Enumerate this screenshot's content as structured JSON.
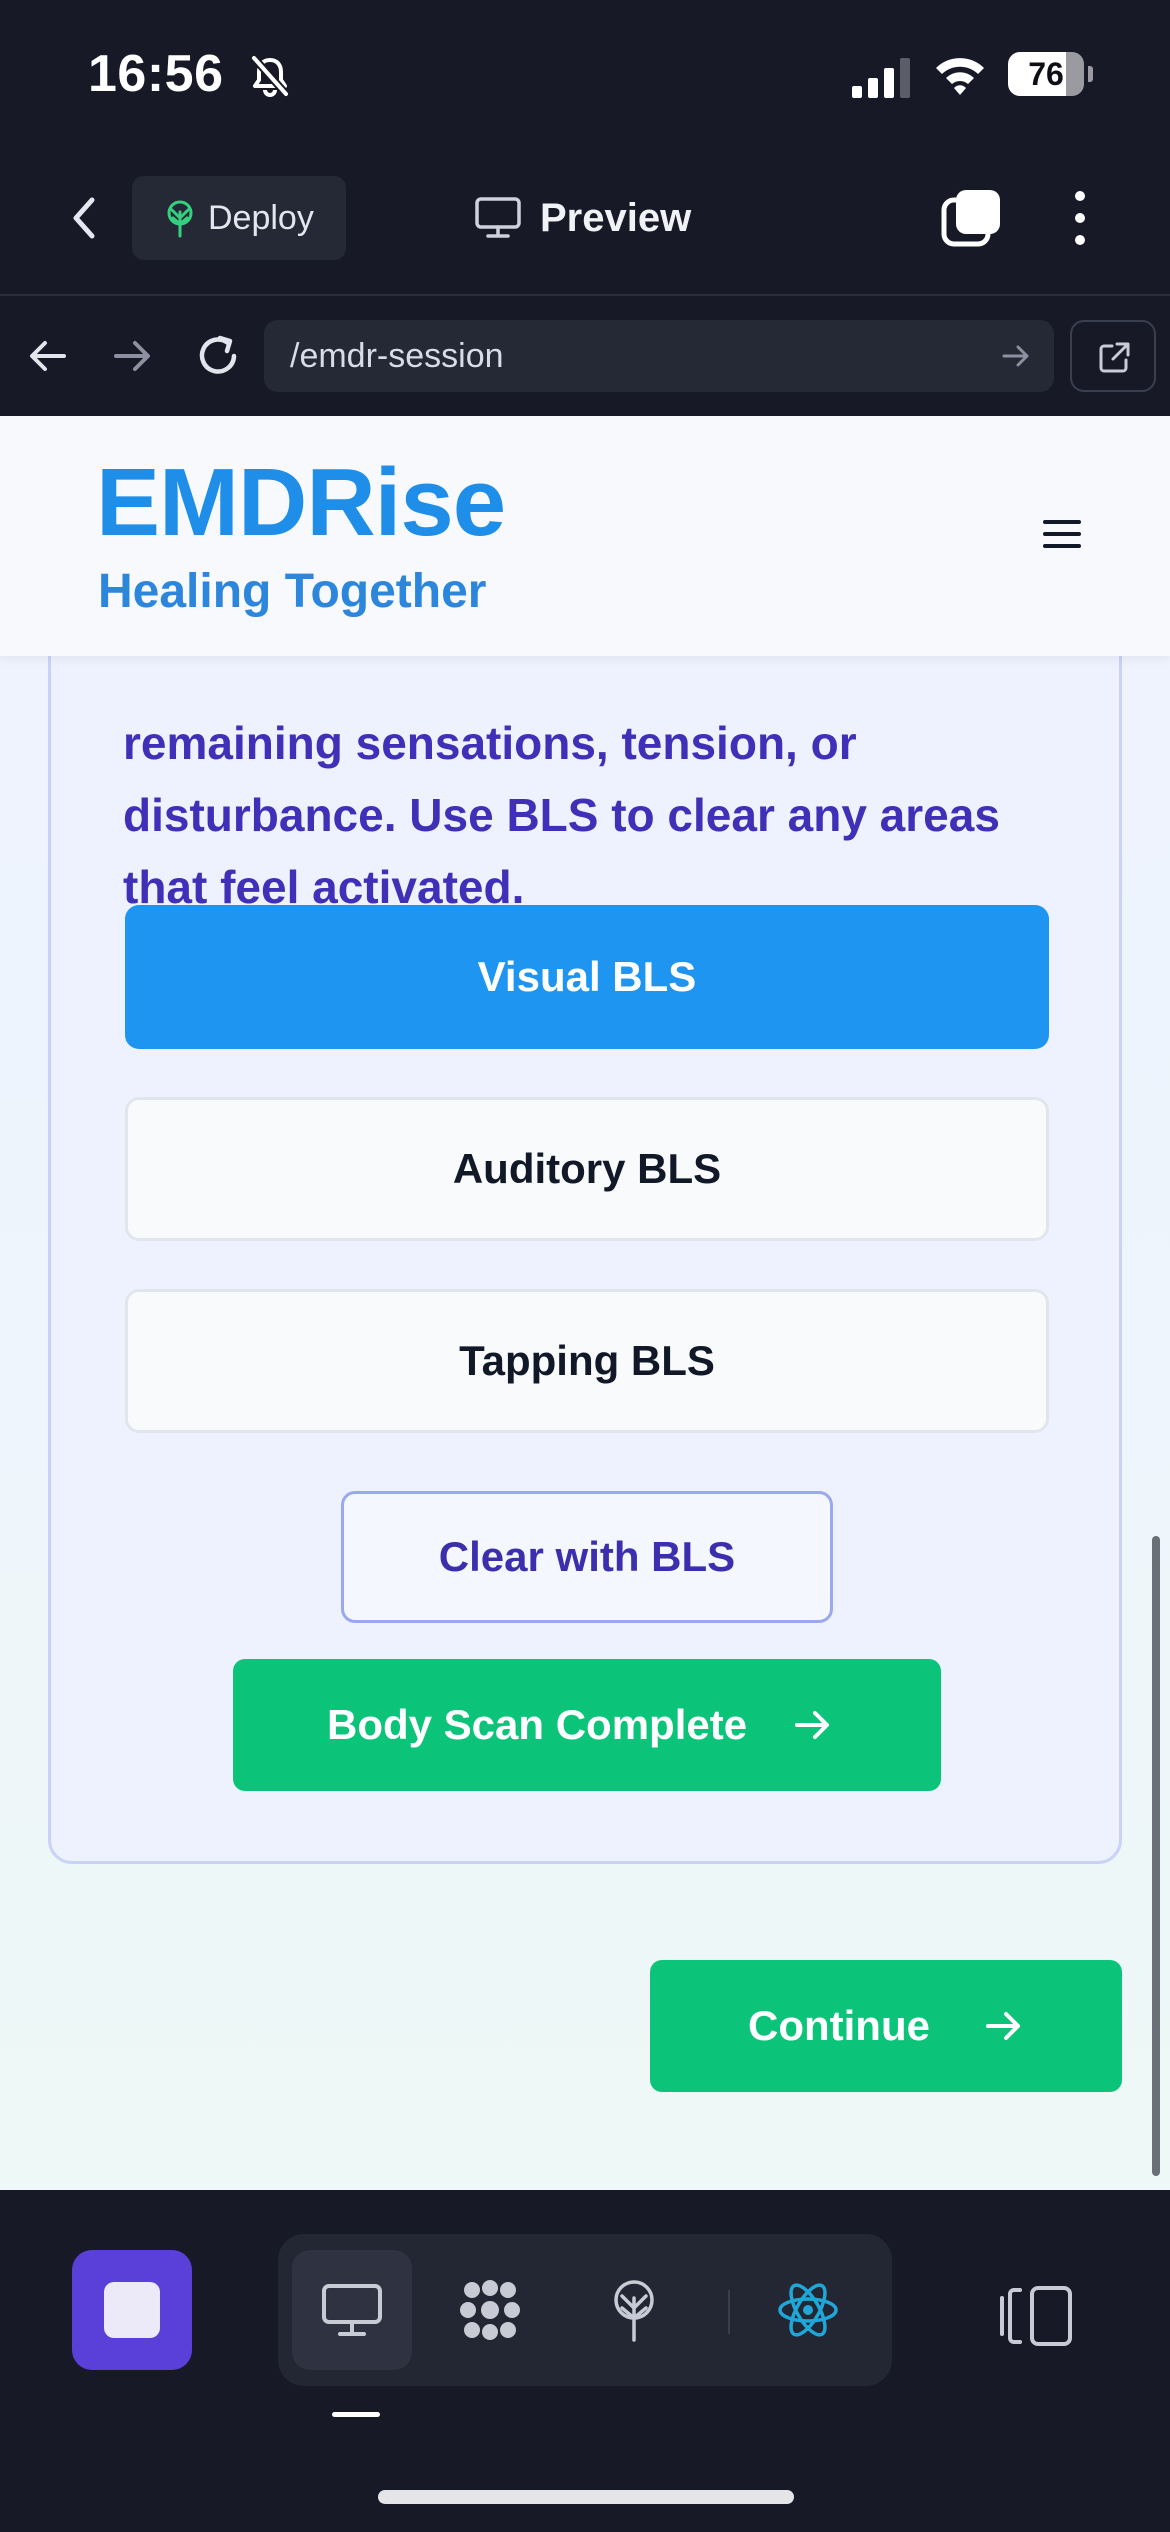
{
  "status_bar": {
    "time": "16:56",
    "battery_percent": "76",
    "battery_level": 0.76,
    "icons": [
      "bell-slash-icon",
      "cellular-signal-icon",
      "wifi-icon",
      "battery-icon"
    ]
  },
  "app_bar": {
    "deploy_label": "Deploy",
    "preview_label": "Preview",
    "icons": [
      "chevron-left-icon",
      "deploy-icon",
      "monitor-icon",
      "tabs-icon",
      "more-vertical-icon"
    ]
  },
  "url_bar": {
    "url": "/emdr-session",
    "icons": [
      "arrow-left-icon",
      "arrow-right-icon",
      "reload-icon",
      "go-arrow-icon",
      "external-link-icon"
    ]
  },
  "site": {
    "logo": "EMDRise",
    "tagline": "Healing Together",
    "menu_icon": "hamburger-icon"
  },
  "card": {
    "instructions_top_partial": "remaining sensations, tension, or",
    "instructions_line2": "disturbance. Use BLS to clear any areas",
    "instructions_line3": "that feel activated.",
    "bls_options": [
      {
        "label": "Visual BLS",
        "selected": true
      },
      {
        "label": "Auditory BLS",
        "selected": false
      },
      {
        "label": "Tapping BLS",
        "selected": false
      }
    ],
    "clear_button": "Clear with BLS",
    "complete_button": "Body Scan Complete"
  },
  "continue_button": "Continue",
  "colors": {
    "brand_blue": "#1f8ee8",
    "selected_blue": "#1f95f2",
    "primary_green": "#0bc47a",
    "text_indigo": "#4030b8",
    "stop_purple": "#5a3fd9",
    "react_cyan": "#1ea7d8"
  },
  "bottom_toolbar": {
    "icons": [
      "stop-icon",
      "desktop-preview-icon",
      "components-icon",
      "deploy-tree-icon",
      "react-icon",
      "device-layout-icon"
    ]
  }
}
